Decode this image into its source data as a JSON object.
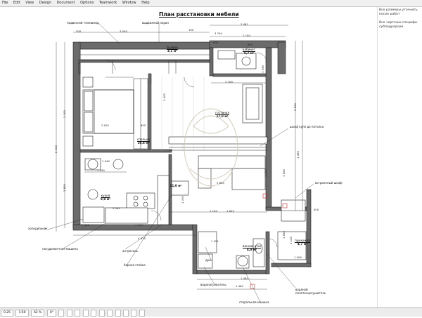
{
  "menu": [
    "File",
    "Edit",
    "View",
    "Design",
    "Document",
    "Options",
    "Teamwork",
    "Window",
    "Help"
  ],
  "drawing": {
    "title": "План расстановки мебели",
    "annotations": {
      "tv": "подвесной телевизор",
      "screen": "выдвижной экран",
      "wardrobe_top": "шкаф купе до потолка",
      "built_in": "встроенный шкаф",
      "fridge": "холодильник",
      "dishwasher": "посудомоечная машина",
      "mezzanine": "антресоль",
      "bar": "барная стойка",
      "shower": "душ",
      "heater": "водонагреватель",
      "towel": "водяной\nполотенцесушитель",
      "washer": "стиральная машина"
    },
    "rooms": [
      {
        "key": "balcony",
        "name": "балкон",
        "area": "3,1 м²"
      },
      {
        "key": "study",
        "name": "кабинет",
        "area": "5,7 м²"
      },
      {
        "key": "living",
        "name": "гостиная",
        "area": "17,0 м²"
      },
      {
        "key": "bedroom",
        "name": "спальня",
        "area": "10,8 м²"
      },
      {
        "key": "kitchen",
        "name": "кухня",
        "area": "9,8 м²"
      },
      {
        "key": "hall",
        "name": "",
        "area": "11,0 м²"
      },
      {
        "key": "bath",
        "name": "ванная к-ка",
        "area": "4,0 м²"
      },
      {
        "key": "hallway",
        "name": "прихожая",
        "area": "4,7 м²"
      }
    ],
    "dims": {
      "d3500": "3 500",
      "d2481": "2 481",
      "d3700a": "3 700",
      "d1190": "1 190",
      "d3700b": "3 700",
      "d2000": "2 000",
      "d1940": "1 940",
      "d1340": "1 340",
      "d1540": "1 540",
      "d4619": "4 619",
      "d3600": "3 600",
      "d1100": "1 100",
      "d1603": "1 603",
      "d1421": "1 421",
      "d1480": "1 480",
      "d3100": "3 100",
      "d6000": "6 000",
      "d2800": "2 800",
      "d2500": "2 500",
      "d1145": "1 145",
      "d1000": "1 000",
      "d900": "900",
      "d400": "400",
      "d100": "100",
      "d300": "300",
      "d600": "600",
      "d1460": "1 460",
      "d855": "855",
      "d2400": "2 400",
      "d1200": "1 200",
      "d1570": "1 570",
      "d1905": "1 905",
      "d1090": "1 090",
      "d1460b": "1 460",
      "d1400": "1 400",
      "d1050": "1 050",
      "d1830": "1 830"
    }
  },
  "sidebar": {
    "note1": "Все размеры уточнить после работ",
    "note2": "Все чертежи специфи. субподрядчик"
  },
  "status": [
    "0.25",
    "1:50",
    "62 %",
    "0°",
    "",
    "",
    "",
    "",
    "",
    "",
    "",
    "",
    "",
    "",
    ""
  ]
}
